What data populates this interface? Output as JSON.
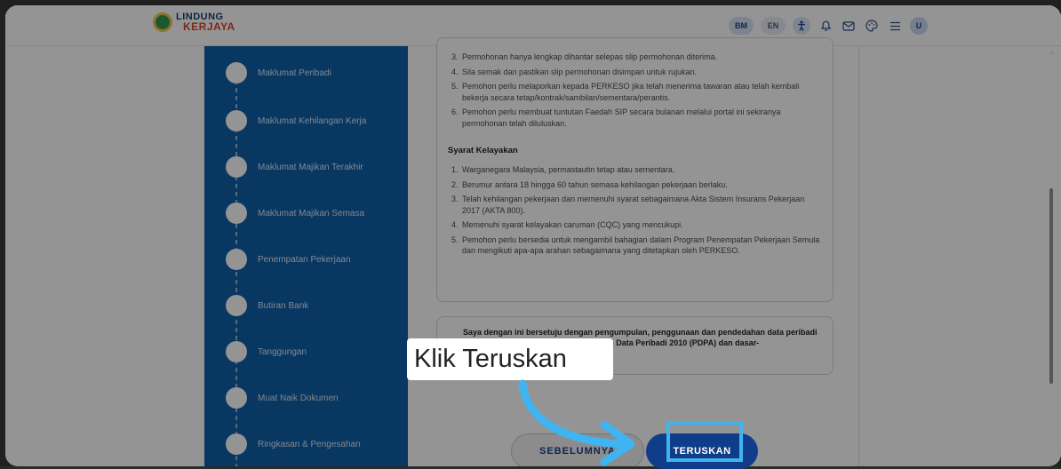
{
  "header": {
    "logo_line1": "LINDUNG",
    "logo_line2": "KERJAYA",
    "lang_bm": "BM",
    "lang_en": "EN",
    "avatar_initial": "U",
    "icons": [
      "accessibility-icon",
      "bell-icon",
      "mail-icon",
      "palette-icon",
      "menu-icon"
    ]
  },
  "sidebar": {
    "steps": [
      "Maklumat Peribadi",
      "Maklumat Kehilangan Kerja",
      "Maklumat Majikan Terakhir",
      "Maklumat Majikan Semasa",
      "Penempatan Pekerjaan",
      "Butiran Bank",
      "Tanggungan",
      "Muat Naik Dokumen",
      "Ringkasan & Pengesahan"
    ]
  },
  "terms": {
    "items_top": [
      {
        "num": "3.",
        "text": "Permohonan hanya lengkap dihantar selepas slip permohonan diterima."
      },
      {
        "num": "4.",
        "text": "Sila semak dan pastikan slip permohonan disimpan untuk rujukan."
      },
      {
        "num": "5.",
        "text": "Pemohon perlu melaporkan kepada PERKESO jika telah menerima tawaran atau telah kembali bekerja secara tetap/kontrak/sambilan/sementara/perantis."
      },
      {
        "num": "6.",
        "text": "Pemohon perlu membuat tuntutan Faedah SIP secara bulanan melalui portal ini sekiranya permohonan telah diluluskan."
      }
    ],
    "eligibility_title": "Syarat Kelayakan",
    "eligibility": [
      {
        "num": "1.",
        "text": "Warganegara Malaysia, permastautin tetap atau sementara."
      },
      {
        "num": "2.",
        "text": "Berumur antara 18 hingga 60 tahun semasa kehilangan pekerjaan berlaku."
      },
      {
        "num": "3.",
        "text": "Telah kehilangan pekerjaan dan memenuhi syarat sebagaimana Akta Sistem Insurans Pekerjaan 2017 (AKTA 800)."
      },
      {
        "num": "4.",
        "text": "Memenuhi syarat kelayakan caruman (CQC) yang mencukupi."
      },
      {
        "num": "5.",
        "text": "Pemohon perlu bersedia untuk mengambil bahagian dalam Program Penempatan Pekerjaan Semula dan mengikuti apa-apa arahan sebagaimana yang ditetapkan oleh PERKESO."
      }
    ]
  },
  "consent": {
    "text": "Saya dengan ini bersetuju dengan pengumpulan, penggunaan dan pendedahan data peribadi saya selaras dengan Akta Perlindungan Data Peribadi 2010 (PDPA) dan dasar-"
  },
  "buttons": {
    "back": "SEBELUMNYA",
    "next": "TERUSKAN"
  },
  "tutorial": {
    "callout": "Klik Teruskan"
  },
  "colors": {
    "sidebar": "#0f5faa",
    "primary_button": "#0f3d8a",
    "highlight": "#3fb4f0"
  }
}
